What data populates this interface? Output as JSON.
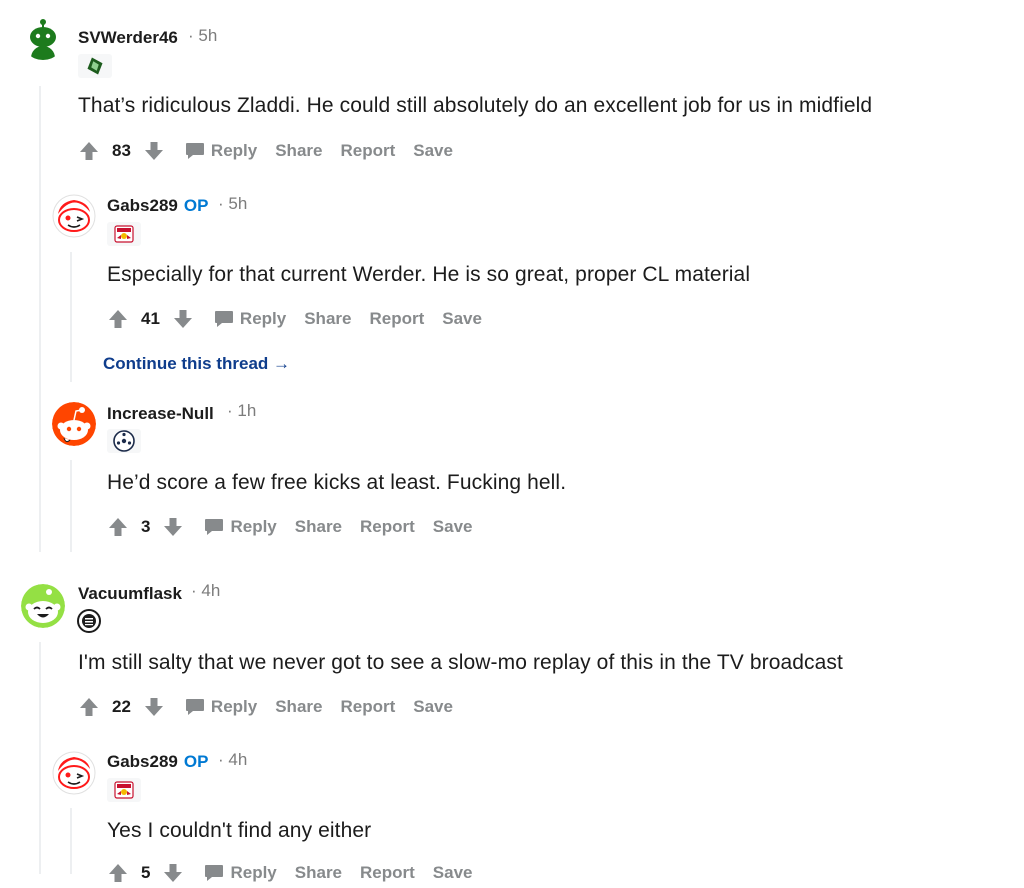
{
  "comments": [
    {
      "username": "SVWerder46",
      "op": "",
      "time": "· 5h",
      "body": "That’s ridiculous Zladdi. He could still absolutely do an excellent job for us in midfield",
      "score": "83",
      "avatar_color": "#1d7b1d",
      "flair_icon": "werder-crest-icon"
    },
    {
      "username": "Gabs289",
      "op": "OP",
      "time": "· 5h",
      "body": "Especially for that current Werder. He is so great, proper CL material",
      "score": "41",
      "avatar_color": "#ff4500",
      "flair_icon": "redbull-crest-icon"
    },
    {
      "username": "Increase-Null",
      "op": "",
      "time": "· 1h",
      "body": "He’d score a few free kicks at least. Fucking hell.",
      "score": "3",
      "avatar_color": "#ff4500",
      "flair_icon": "football-icon"
    },
    {
      "username": "Vacuumflask",
      "op": "",
      "time": "· 4h",
      "body": "I'm still salty that we never got to see a slow-mo replay of this in the TV broadcast",
      "score": "22",
      "avatar_color": "#94e044",
      "flair_icon": "club-badge-icon"
    },
    {
      "username": "Gabs289",
      "op": "OP",
      "time": "· 4h",
      "body": "Yes I couldn't find any either",
      "score": "5",
      "avatar_color": "#ff4500",
      "flair_icon": "redbull-crest-icon"
    }
  ],
  "actions": {
    "reply": "Reply",
    "share": "Share",
    "report": "Report",
    "save": "Save"
  },
  "continue_thread": "Continue this thread →"
}
